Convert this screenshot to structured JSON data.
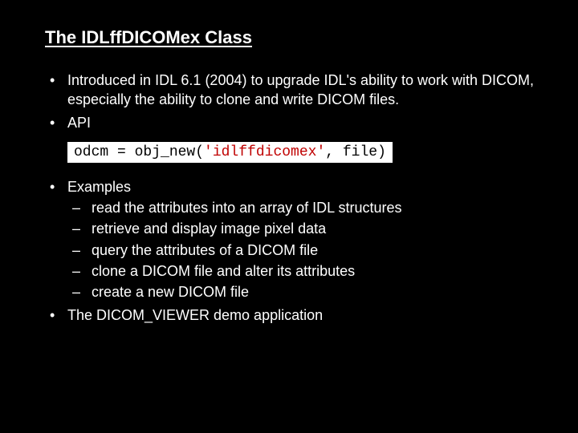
{
  "title": "The IDLffDICOMex Class",
  "bullets": {
    "intro": "Introduced in IDL 6.1 (2004) to upgrade IDL's ability to work with DICOM, especially the ability to clone and write DICOM files.",
    "api": "API",
    "examples": "Examples",
    "examples_sub": [
      "read the attributes into an array of IDL structures",
      "retrieve and display image pixel data",
      "query the attributes of a DICOM file",
      "clone a DICOM file and alter its attributes",
      "create a new DICOM file"
    ],
    "demo": "The DICOM_VIEWER demo application"
  },
  "code": {
    "pre": "odcm = obj_new(",
    "str": "'idlffdicomex'",
    "post": ", file)"
  }
}
